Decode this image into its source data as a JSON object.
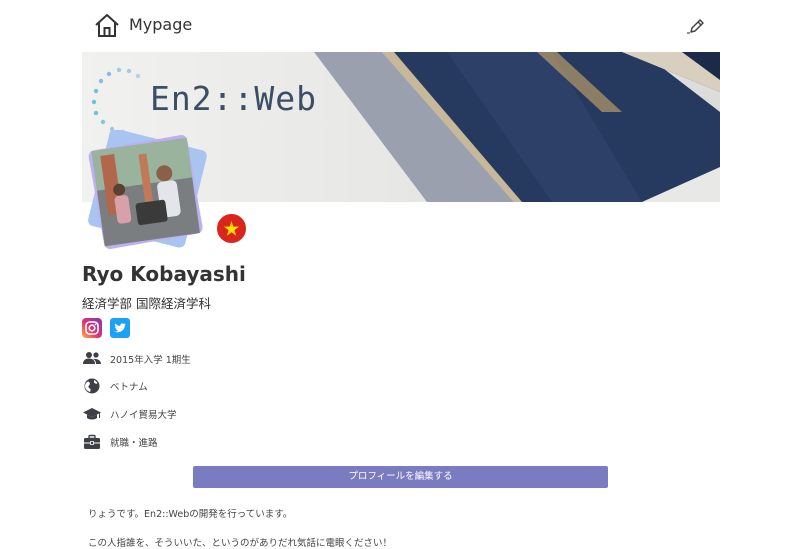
{
  "header": {
    "title": "Mypage"
  },
  "cover": {
    "logo_text": "En2::Web"
  },
  "profile": {
    "name": "Ryo Kobayashi",
    "department": "経済学部 国際経済学科",
    "social": [
      "instagram-icon",
      "twitter-icon"
    ]
  },
  "info": [
    {
      "icon": "group-icon",
      "text": "2015年入学 1期生"
    },
    {
      "icon": "globe-icon",
      "text": "ベトナム"
    },
    {
      "icon": "graduation-cap-icon",
      "text": "ハノイ貿易大学"
    },
    {
      "icon": "briefcase-icon",
      "text": "就職・進路"
    }
  ],
  "actions": {
    "edit_profile": "プロフィールを編集する"
  },
  "bio": {
    "line1": "りょうです。En2::Webの開発を行っています。",
    "line2": "この人指誰を、そういいた、というのがありだれ気話に電眼ください！"
  },
  "colors": {
    "accent": "#7b7bc2",
    "flag_red": "#da251d",
    "flag_star": "#ffde00"
  }
}
